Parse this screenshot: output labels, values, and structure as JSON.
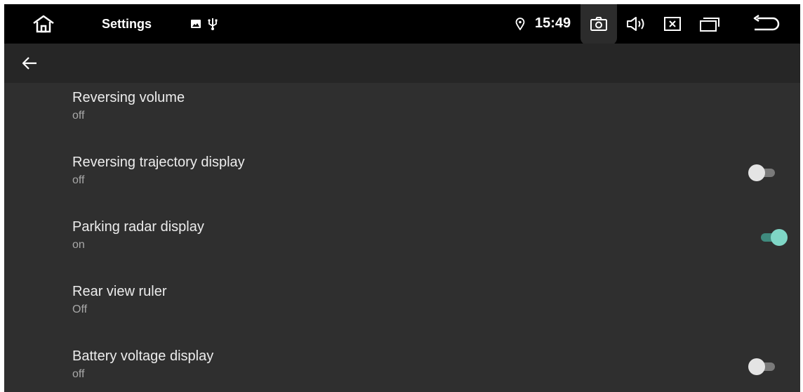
{
  "status_bar": {
    "app_title": "Settings",
    "time": "15:49",
    "icons": [
      "home-icon",
      "image-notification-icon",
      "usb-icon",
      "location-icon",
      "screenshot-camera-icon",
      "volume-icon",
      "close-window-icon",
      "recent-apps-icon",
      "back-arrow-icon"
    ]
  },
  "app_bar": {
    "back_icon": "arrow-left-icon"
  },
  "settings": [
    {
      "title": "Reversing volume",
      "summary": "off",
      "has_switch": false
    },
    {
      "title": "Reversing trajectory display",
      "summary": "off",
      "has_switch": true,
      "switch_on": false
    },
    {
      "title": "Parking radar display",
      "summary": "on",
      "has_switch": true,
      "switch_on": true
    },
    {
      "title": "Rear view ruler",
      "summary": "Off",
      "has_switch": false
    },
    {
      "title": "Battery voltage display",
      "summary": "off",
      "has_switch": true,
      "switch_on": false
    }
  ],
  "colors": {
    "background": "#2f2f2f",
    "status_bar": "#000000",
    "app_bar": "#262626",
    "switch_on_thumb": "#7fd6c6",
    "switch_on_track": "#3f8a7e",
    "switch_off_thumb": "#e4e4e4",
    "switch_off_track": "#7a7a7a"
  }
}
